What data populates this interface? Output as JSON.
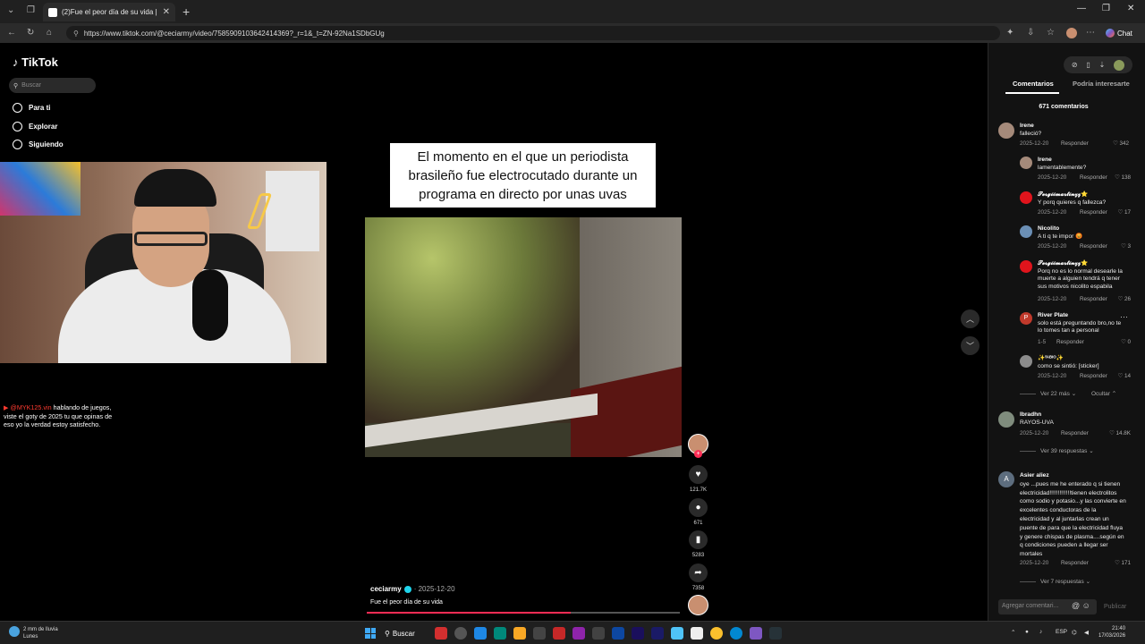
{
  "browser": {
    "tab_title": "(2)Fue el peor día de su vida | uva...",
    "url": "https://www.tiktok.com/@ceciarmy/video/7585909103642414369?_r=1&_t=ZN-92Na1SDbGUg",
    "chat_label": "Chat"
  },
  "sidebar": {
    "logo": "TikTok",
    "search_placeholder": "Buscar",
    "items": [
      {
        "label": "Para ti",
        "icon": "home-icon"
      },
      {
        "label": "Explorar",
        "icon": "compass-icon"
      },
      {
        "label": "Siguiendo",
        "icon": "following-icon"
      }
    ]
  },
  "stream_chat": {
    "user": "@MYK125.vin",
    "message": "hablando de juegos, viste el goty de 2025 tu que opinas de eso yo la verdad estoy satisfecho."
  },
  "video": {
    "caption": "El momento en el que un periodista brasileño fue electrocutado durante un programa en directo por unas uvas",
    "author": "ceciarmy",
    "date": "· 2025-12-20",
    "description": "Fue el peor día de su vida",
    "progress": 0.65
  },
  "actions": {
    "likes": "121.7K",
    "comments": "671",
    "saves": "5283",
    "shares": "7358"
  },
  "comments_panel": {
    "tabs": [
      "Comentarios",
      "Podría interesarte"
    ],
    "count_label": "671 comentarios",
    "comments": [
      {
        "name": "Irene",
        "text": "falleció?",
        "date": "2025-12-20",
        "reply": "Responder",
        "likes": "342"
      },
      {
        "name": "Irene",
        "text": "lamentablemente?",
        "date": "2025-12-20",
        "reply": "Responder",
        "likes": "138"
      },
      {
        "name": "𝓢𝓮𝓻𝓰𝓲𝓲𝓶𝓪𝓻𝓽𝓲𝓷𝔃𝔃⭐",
        "text": "Y porq quieres q fallezca?",
        "date": "2025-12-20",
        "reply": "Responder",
        "likes": "17"
      },
      {
        "name": "Nicolito",
        "text": "A ti q te impor 😡",
        "date": "2025-12-20",
        "reply": "Responder",
        "likes": "3"
      },
      {
        "name": "𝓢𝓮𝓻𝓰𝓲𝓲𝓶𝓪𝓻𝓽𝓲𝓷𝔃𝔃⭐",
        "text": "Porq no es lo normal desearle la muerte a alguien tendrá q tener sus motivos nicolito espabila",
        "date": "2025-12-20",
        "reply": "Responder",
        "likes": "26"
      },
      {
        "name": "River Plate",
        "text": "solo está preguntando bro,no te lo tomes tan a personal",
        "date": "1-5",
        "reply": "Responder",
        "likes": "0"
      },
      {
        "name": "✨ᶠᴬᴮᴵᴼ✨",
        "text": "como se sintió: [sticker]",
        "date": "2025-12-20",
        "reply": "Responder",
        "likes": "14"
      },
      {
        "name": "Ibradhn",
        "text": "RAYOS-UVA",
        "date": "2025-12-20",
        "reply": "Responder",
        "likes": "14.8K"
      },
      {
        "name": "Asier aliez",
        "text": "oye ...pues me he enterado q si tienen electricidad!!!!!!!!!!!!!tienen electrolitos como sodio y potasio...y las convierte en excelentes conductoras de la electricidad y al juntarlas crean un puente de para que la electricidad fluya y genere chispas de plasma....según en q condiciones pueden a llegar ser mortales",
        "date": "2025-12-20",
        "reply": "Responder",
        "likes": "171"
      }
    ],
    "more_1": "Ver 22 más",
    "hide_1": "Ocultar",
    "more_2": "Ver 39 respuestas",
    "more_3": "Ver 7 respuestas",
    "add_placeholder": "Agregar comentari...",
    "publish": "Publicar"
  },
  "taskbar": {
    "weather_line1": "2 mm de lluvia",
    "weather_line2": "Lunes",
    "search": "Buscar",
    "lang": "ESP",
    "time": "21:40",
    "date": "17/03/2026"
  },
  "colors": {
    "accent": "#fe2c55",
    "verified": "#20d5ec",
    "background": "#000000"
  }
}
